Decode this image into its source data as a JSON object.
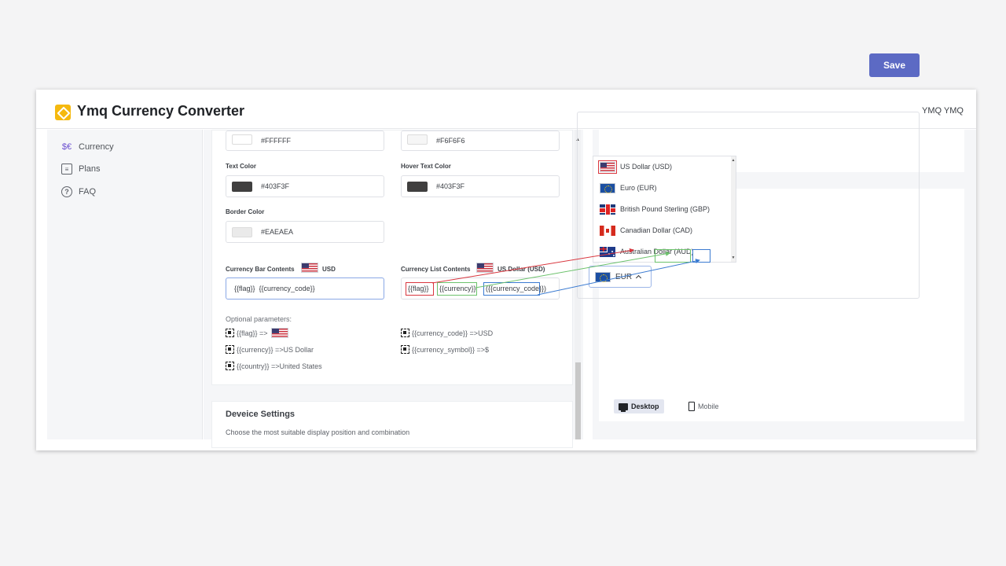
{
  "app": {
    "title": "Ymq Currency Converter",
    "user": "YMQ YMQ"
  },
  "sidebar": {
    "items": [
      {
        "label": "Currency",
        "icon": "currency-icon"
      },
      {
        "label": "Plans",
        "icon": "list-icon"
      },
      {
        "label": "FAQ",
        "icon": "question-icon"
      }
    ]
  },
  "settings": {
    "background_color": "#FFFFFF",
    "hover_background_color": "#F6F6F6",
    "text_color_label": "Text Color",
    "text_color": "#403F3F",
    "hover_text_color_label": "Hover Text Color",
    "hover_text_color": "#403F3F",
    "border_color_label": "Border Color",
    "border_color": "#EAEAEA",
    "bar_contents_label": "Currency Bar Contents",
    "bar_contents_preview": "USD",
    "bar_contents_value": "{{flag}}  {{currency_code}}",
    "list_contents_label": "Currency List Contents",
    "list_contents_preview": "US Dollar (USD)",
    "list_tokens": [
      "{{flag}}",
      "{{currency}}",
      "({{currency_code}})"
    ],
    "optional_label": "Optional parameters:",
    "params": {
      "flag": "{{flag}} =>",
      "currency_code": "{{currency_code}} =>USD",
      "currency": "{{currency}} =>US Dollar",
      "currency_symbol": "{{currency_symbol}} =>$",
      "country": "{{country}} =>United States"
    }
  },
  "device_settings": {
    "title": "Deveice Settings",
    "subtitle": "Choose the most suitable display position and combination"
  },
  "preview": {
    "save_label": "Save",
    "list": [
      {
        "flag": "us",
        "label": "US Dollar (USD)"
      },
      {
        "flag": "eu",
        "label": "Euro (EUR)"
      },
      {
        "flag": "gb",
        "label": "British Pound Sterling (GBP)"
      },
      {
        "flag": "ca",
        "label": "Canadian Dollar (CAD)"
      },
      {
        "flag": "au",
        "label": "Australian Dollar (AUD)"
      }
    ],
    "selected": "EUR",
    "tabs": {
      "desktop": "Desktop",
      "mobile": "Mobile"
    }
  },
  "colors": {
    "accent": "#5C6AC4",
    "highlight_red": "#D9363E",
    "highlight_green": "#6CC26C",
    "highlight_blue": "#3B7BD1"
  }
}
